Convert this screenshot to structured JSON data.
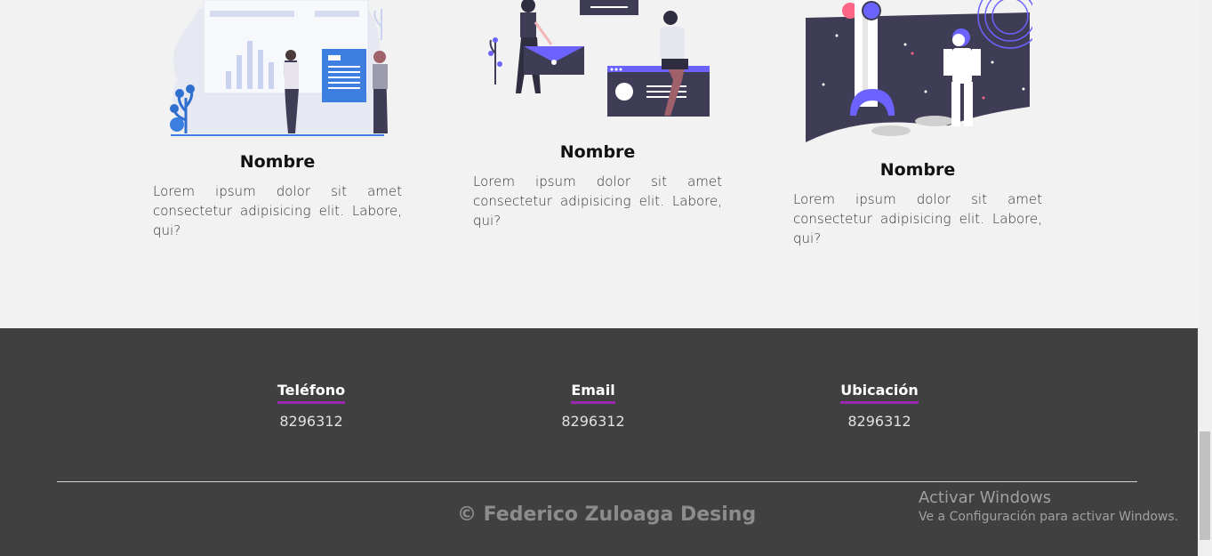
{
  "cards": [
    {
      "title": "Nombre",
      "text": "Lorem ipsum dolor sit amet consectetur adipisicing elit. Labore, qui?",
      "illustration": "presentation-charts-illustration"
    },
    {
      "title": "Nombre",
      "text": "Lorem ipsum dolor sit amet consectetur adipisicing elit. Labore, qui?",
      "illustration": "messages-envelope-illustration"
    },
    {
      "title": "Nombre",
      "text": "Lorem ipsum dolor sit amet consectetur adipisicing elit. Labore, qui?",
      "illustration": "astronaut-rocket-illustration"
    }
  ],
  "footer": {
    "contacts": [
      {
        "title": "Teléfono",
        "value": "8296312"
      },
      {
        "title": "Email",
        "value": "8296312"
      },
      {
        "title": "Ubicación",
        "value": "8296312"
      }
    ],
    "copyright": "© Federico Zuloaga Desing",
    "accent_color": "#9c27b0"
  },
  "windows_watermark": {
    "title": "Activar Windows",
    "subtitle": "Ve a Configuración para activar Windows."
  }
}
